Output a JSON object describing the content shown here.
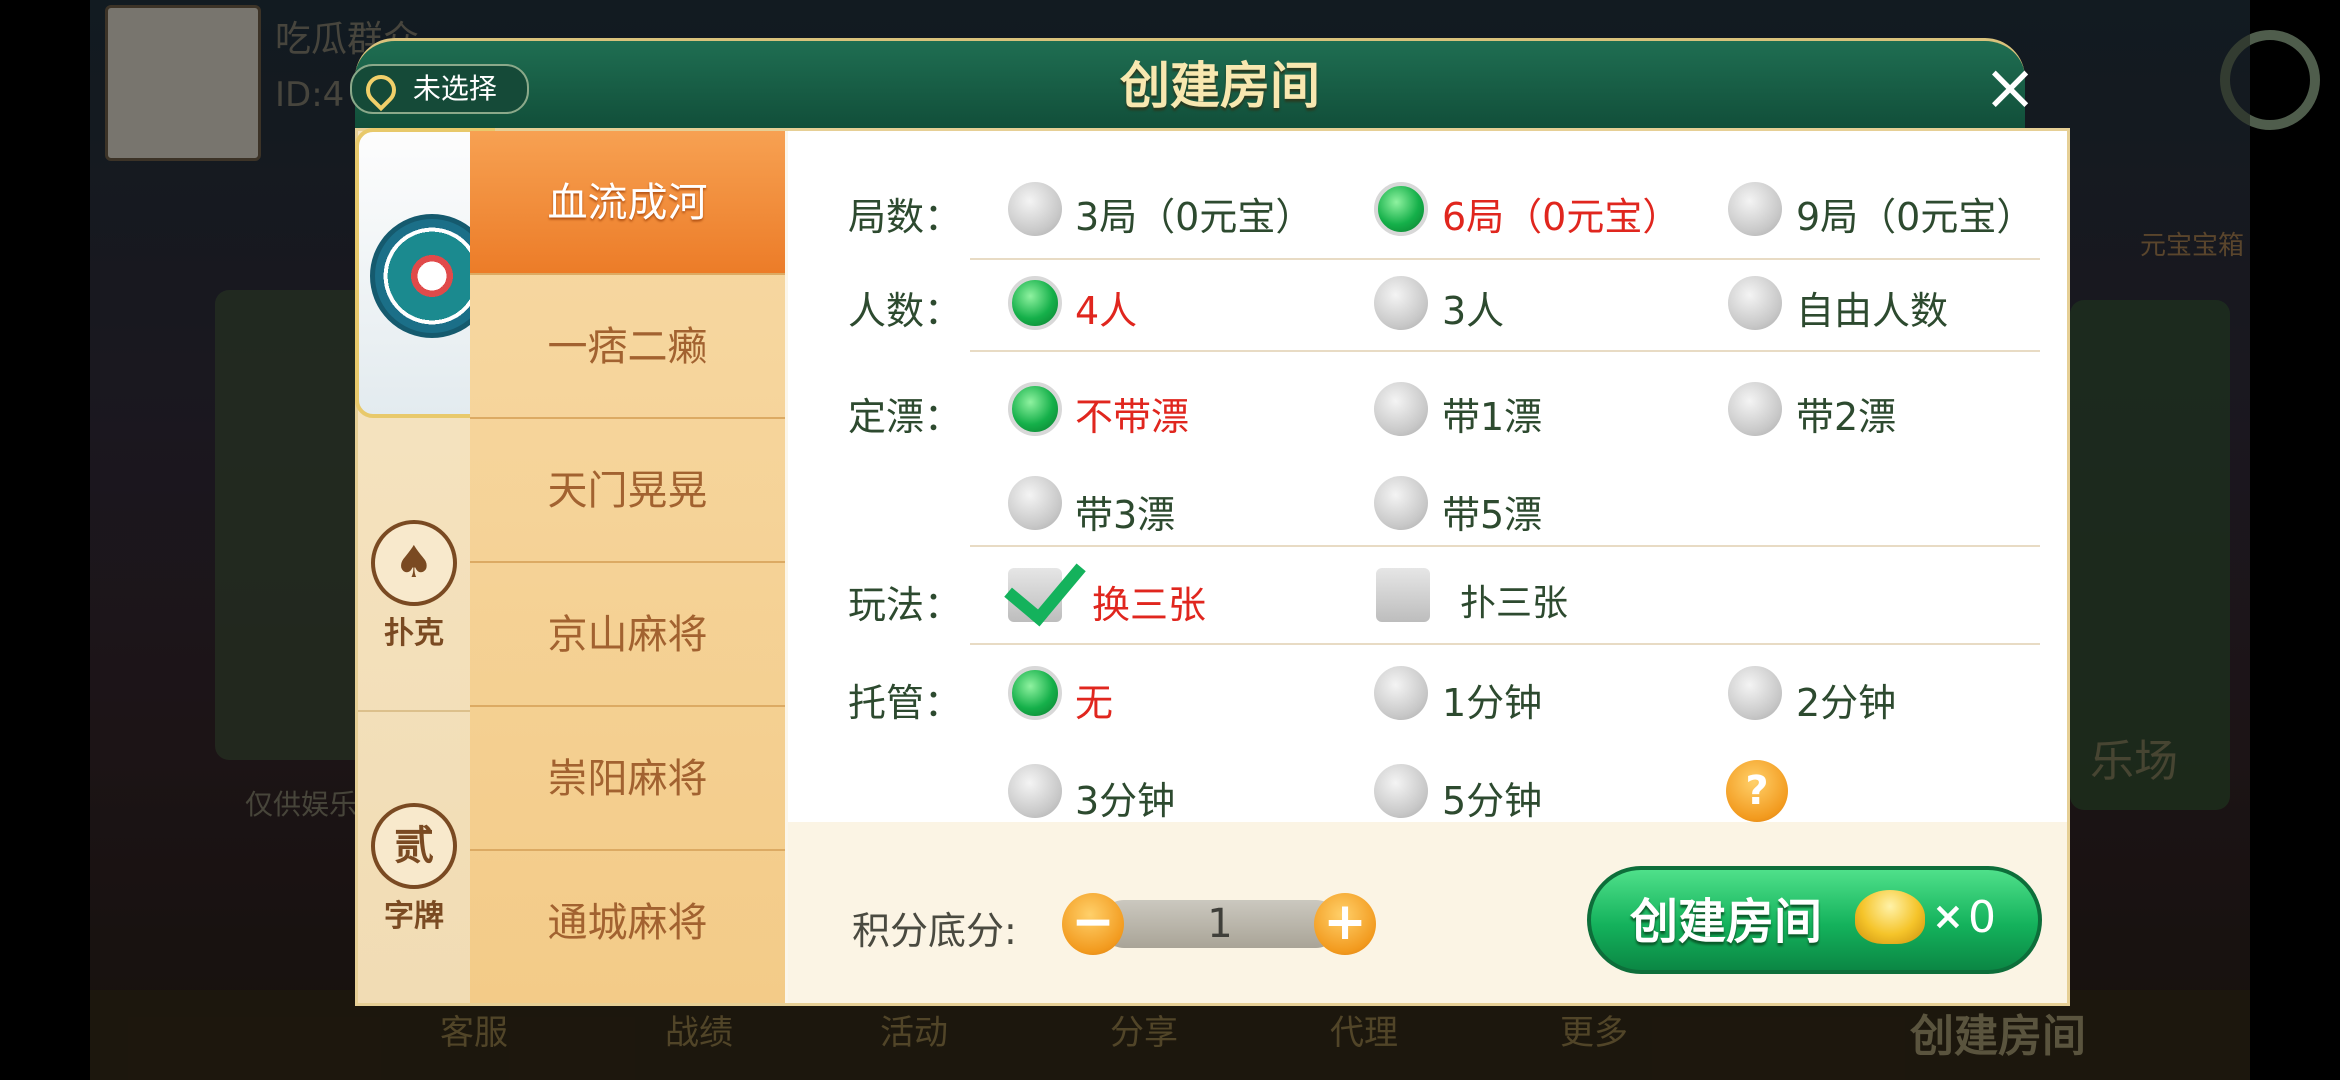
{
  "background": {
    "user_name": "吃瓜群众",
    "user_id_prefix": "ID:4",
    "side_labels": [
      "元宝宝箱",
      "乐场"
    ],
    "footer_text": "仅供娱乐",
    "bottom_create_label": "创建房间",
    "bottom_nav": [
      "客服",
      "战绩",
      "活动",
      "分享",
      "代理",
      "更多"
    ]
  },
  "dialog": {
    "title": "创建房间",
    "location_label": "未选择",
    "categories": [
      {
        "label": "",
        "icon": "mahjong-emblem-icon"
      },
      {
        "label": "扑克",
        "icon": "spade-icon"
      },
      {
        "label": "字牌",
        "icon": "zi-pai-icon",
        "glyph": "贰"
      }
    ],
    "games": [
      "血流成河",
      "一痞二癞",
      "天门晃晃",
      "京山麻将",
      "崇阳麻将",
      "通城麻将"
    ],
    "rows": {
      "rounds": {
        "label": "局数：",
        "options": [
          "3局（0元宝）",
          "6局（0元宝）",
          "9局（0元宝）"
        ],
        "selected": 1
      },
      "players": {
        "label": "人数：",
        "options": [
          "4人",
          "3人",
          "自由人数"
        ],
        "selected": 0
      },
      "piao": {
        "label": "定漂：",
        "options": [
          "不带漂",
          "带1漂",
          "带2漂",
          "带3漂",
          "带5漂"
        ],
        "selected": 0
      },
      "play": {
        "label": "玩法：",
        "options": [
          "换三张",
          "扑三张"
        ],
        "checked": [
          true,
          false
        ]
      },
      "trust": {
        "label": "托管：",
        "options": [
          "无",
          "1分钟",
          "2分钟",
          "3分钟",
          "5分钟"
        ],
        "selected": 0
      }
    },
    "score": {
      "label": "积分底分:",
      "value": "1",
      "minus": "−",
      "plus": "+"
    },
    "create_button": {
      "label": "创建房间",
      "cost_prefix": "×",
      "cost": "0"
    }
  },
  "colors": {
    "accent_green": "#14b25c",
    "selected_text": "#e0261e",
    "tab_orange": "#ec7c28"
  }
}
